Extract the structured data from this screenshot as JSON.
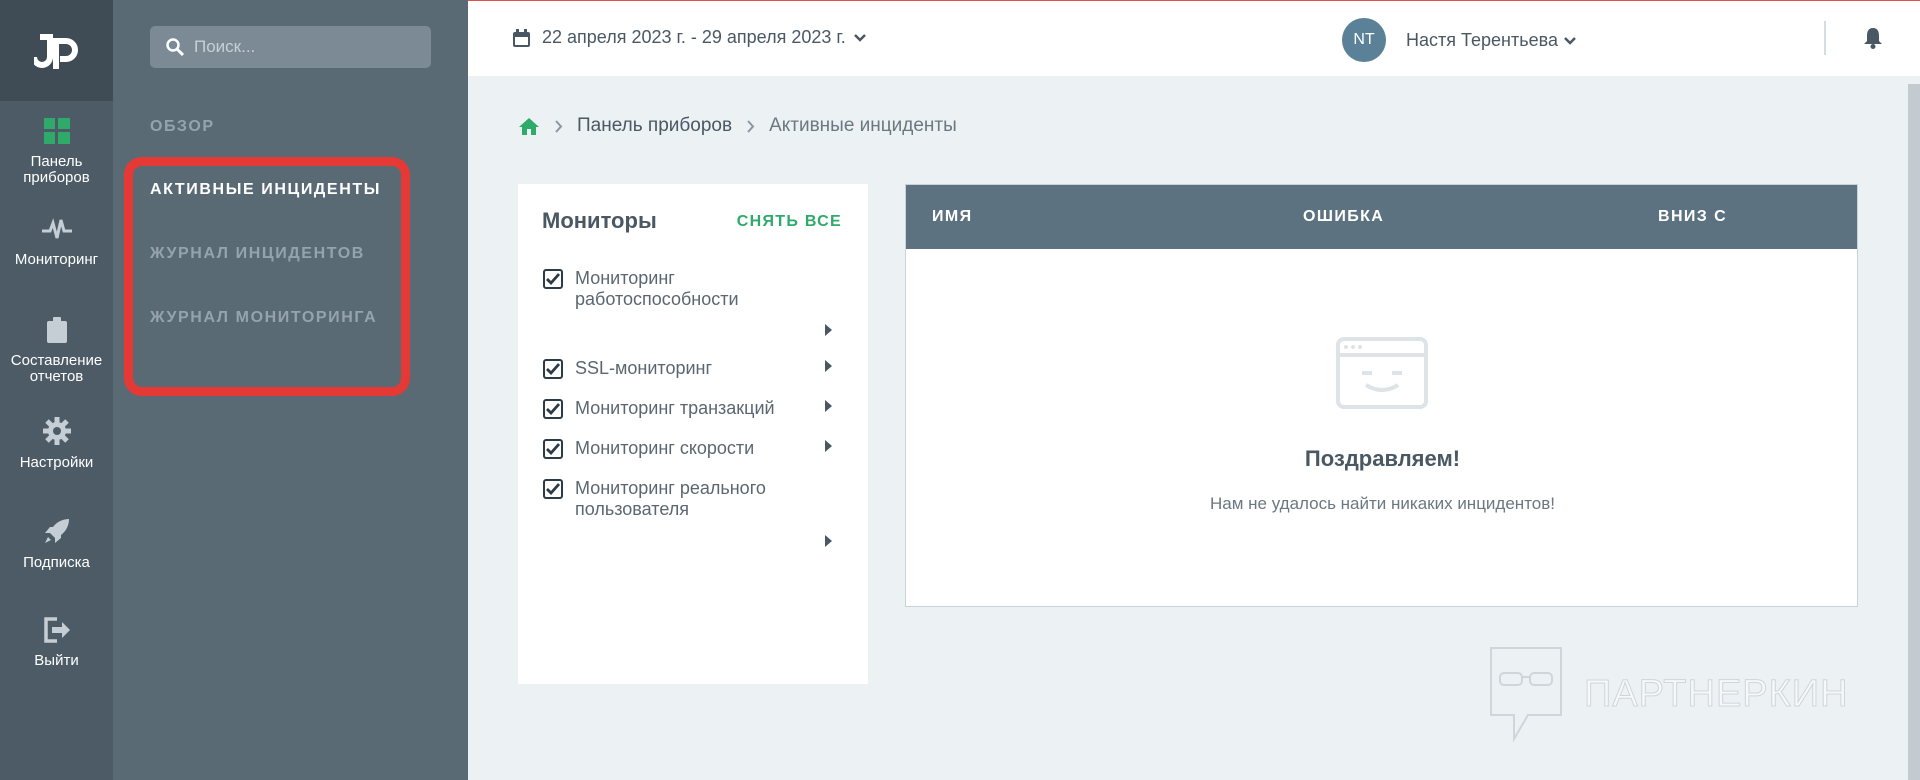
{
  "app": {
    "logo": "logo-icon",
    "colors": {
      "accent": "#2eaa6b",
      "rail_bg": "#4c5b66",
      "sidebar_bg": "#5a6a75",
      "table_header_bg": "#5d7280",
      "highlight": "#e53935"
    }
  },
  "rail": {
    "items": [
      {
        "label": "Панель приборов",
        "icon": "dashboard-grid-icon"
      },
      {
        "label": "Мониторинг",
        "icon": "pulse-icon"
      },
      {
        "label": "Составление отчетов",
        "icon": "clipboard-icon"
      },
      {
        "label": "Настройки",
        "icon": "gear-icon"
      },
      {
        "label": "Подписка",
        "icon": "rocket-icon"
      },
      {
        "label": "Выйти",
        "icon": "logout-icon"
      }
    ]
  },
  "sidebar": {
    "search_placeholder": "Поиск...",
    "items": [
      {
        "label": "ОБЗОР"
      },
      {
        "label": "АКТИВНЫЕ ИНЦИДЕНТЫ"
      },
      {
        "label": "ЖУРНАЛ ИНЦИДЕНТОВ"
      },
      {
        "label": "ЖУРНАЛ МОНИТОРИНГА"
      }
    ]
  },
  "topbar": {
    "date_range": "22 апреля 2023 г. - 29 апреля 2023 г.",
    "user_initials": "NT",
    "user_name": "Настя Терентьева"
  },
  "breadcrumb": {
    "items": [
      "Панель приборов",
      "Активные инциденты"
    ]
  },
  "monitors": {
    "title": "Мониторы",
    "uncheck_all": "СНЯТЬ ВСЕ",
    "items": [
      {
        "label": "Мониторинг работоспособности",
        "checked": true
      },
      {
        "label": "SSL-мониторинг",
        "checked": true
      },
      {
        "label": "Мониторинг транзакций",
        "checked": true
      },
      {
        "label": "Мониторинг скорости",
        "checked": true
      },
      {
        "label": "Мониторинг реального пользователя",
        "checked": true
      }
    ]
  },
  "incidents": {
    "columns": [
      "ИМЯ",
      "ОШИБКА",
      "ВНИЗ С"
    ],
    "empty_title": "Поздравляем!",
    "empty_text": "Нам не удалось найти никаких инцидентов!"
  },
  "watermark": {
    "text": "ПАРТНЕРКИН"
  }
}
